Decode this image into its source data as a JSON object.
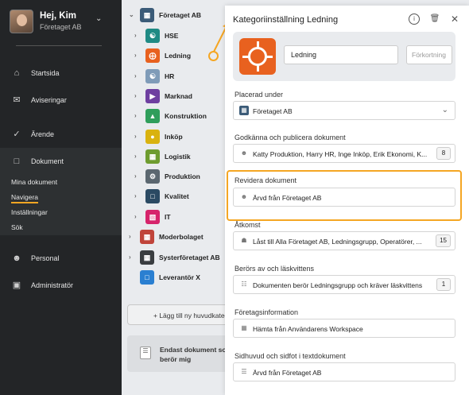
{
  "sidebar": {
    "user": {
      "name": "Hej, Kim",
      "org": "Företaget AB"
    },
    "nav": [
      {
        "label": "Startsida",
        "icon": "home-icon"
      },
      {
        "label": "Aviseringar",
        "icon": "inbox-icon"
      },
      {
        "label": "Ärende",
        "icon": "check-icon"
      },
      {
        "label": "Dokument",
        "icon": "document-icon"
      },
      {
        "label": "Personal",
        "icon": "person-icon"
      },
      {
        "label": "Administratör",
        "icon": "admin-icon"
      }
    ],
    "doc_sub": [
      "Mina dokument",
      "Navigera",
      "Inställningar",
      "Sök"
    ]
  },
  "tree": {
    "root": "Företaget AB",
    "items": [
      "HSE",
      "Ledning",
      "HR",
      "Marknad",
      "Konstruktion",
      "Inköp",
      "Logistik",
      "Produktion",
      "Kvalitet",
      "IT"
    ],
    "others": [
      "Moderbolaget",
      "Systerföretaget AB",
      "Leverantör X"
    ],
    "add_label": "+ Lägg till ny huvudkategori",
    "end_label": "Endast dokument som berör mig"
  },
  "panel": {
    "title": "Kategoriinställning Ledning",
    "name_value": "Ledning",
    "abbr_placeholder": "Förkortning",
    "fields": [
      {
        "label": "Placerad under",
        "value": "Företaget AB"
      },
      {
        "label": "Godkänna och publicera dokument",
        "value": "Katty Produktion, Harry HR, Inge Inköp, Erik Ekonomi, K...",
        "badge": "8"
      },
      {
        "label": "Revidera dokument",
        "value": "Ärvd från Företaget AB"
      },
      {
        "label": "Åtkomst",
        "value": "Låst till Alla Företaget AB, Ledningsgrupp, Operatörer, ...",
        "badge": "15"
      },
      {
        "label": "Berörs av och läskvittens",
        "value": "Dokumenten berör Ledningsgrupp och kräver läskvittens",
        "badge": "1"
      },
      {
        "label": "Företagsinformation",
        "value": "Hämta från Användarens Workspace"
      },
      {
        "label": "Sidhuvud och sidfot i textdokument",
        "value": "Ärvd från Företaget AB"
      }
    ]
  },
  "colors": {
    "accent": "#f5a623",
    "sidebar": "#232527",
    "ledning_icon": "#e8611f"
  }
}
